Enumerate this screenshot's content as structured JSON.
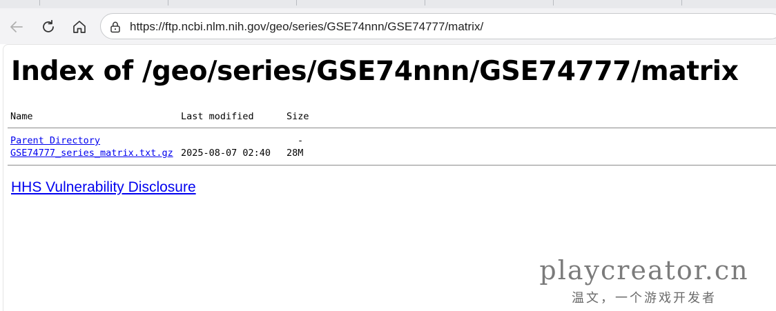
{
  "browser": {
    "address_bar": {
      "url": "https://ftp.ncbi.nlm.nih.gov/geo/series/GSE74nnn/GSE74777/matrix/"
    }
  },
  "page": {
    "title": "Index of /geo/series/GSE74nnn/GSE74777/matrix",
    "table": {
      "headers": {
        "name": "Name",
        "last_modified": "Last modified",
        "size": "Size"
      },
      "rows": [
        {
          "name": "Parent Directory",
          "last_modified": "",
          "size": "-"
        },
        {
          "name": "GSE74777_series_matrix.txt.gz",
          "last_modified": "2025-08-07 02:40",
          "size": "28M"
        }
      ]
    },
    "footer_link": "HHS Vulnerability Disclosure"
  },
  "watermark": {
    "main": "playcreator.cn",
    "sub": "温文，一个游戏开发者"
  }
}
